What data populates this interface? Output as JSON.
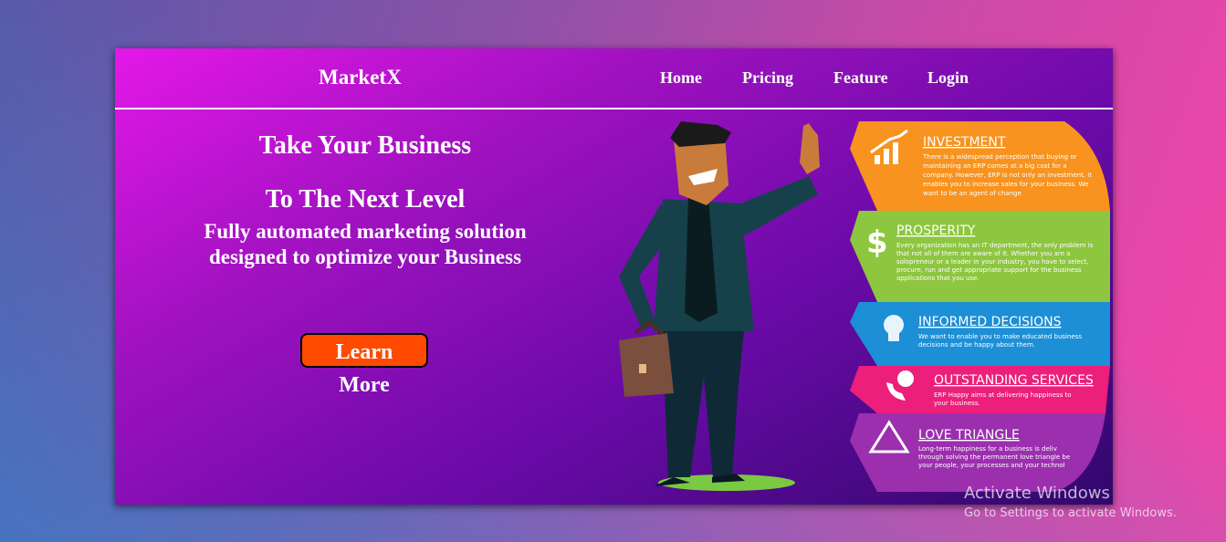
{
  "brand": "MarketX",
  "nav": {
    "home": "Home",
    "pricing": "Pricing",
    "feature": "Feature",
    "login": "Login"
  },
  "hero": {
    "title_line1": "Take Your Business",
    "title_line2": "To The Next Level",
    "subtitle": "Fully automated marketing solution designed to optimize your Business",
    "cta": "Learn More"
  },
  "illustration": {
    "panels": [
      {
        "title": "INVESTMENT",
        "color": "#f7931e",
        "icon": "growth-chart-icon",
        "text": [
          "There is a widespread perception that buying or",
          "maintaining an ERP comes at a big cost for a",
          "company. However, ERP is not only an investment, it",
          "enables you to increase sales for your business. We",
          "want to be an agent of change"
        ]
      },
      {
        "title": "PROSPERITY",
        "color": "#8dc63f",
        "icon": "dollar-icon",
        "text": [
          "Every organization has an IT department, the only problem is",
          "that not all of them are aware of it. Whether you are a",
          "solopreneur or a leader in your industry, you have to select,",
          "procure, run and get appropriate support for the business",
          "applications that you use."
        ]
      },
      {
        "title": "INFORMED DECISIONS",
        "color": "#1c8fd6",
        "icon": "lightbulb-icon",
        "text": [
          "We want to enable you to make educated business",
          "decisions and be happy about them."
        ]
      },
      {
        "title": "OUTSTANDING SERVICES",
        "color": "#ec1f7a",
        "icon": "phone-support-icon",
        "text": [
          "ERP Happy aims at delivering happiness to",
          "your business."
        ]
      },
      {
        "title": "LOVE TRIANGLE",
        "color": "#9b2fae",
        "icon": "triangle-icon",
        "text": [
          "Long-term happiness for a business is deliv",
          "through solving the permanent love triangle be",
          "your people, your processes and your technol"
        ]
      }
    ]
  },
  "watermark": {
    "line1": "Activate Windows",
    "line2": "Go to Settings to activate Windows."
  }
}
